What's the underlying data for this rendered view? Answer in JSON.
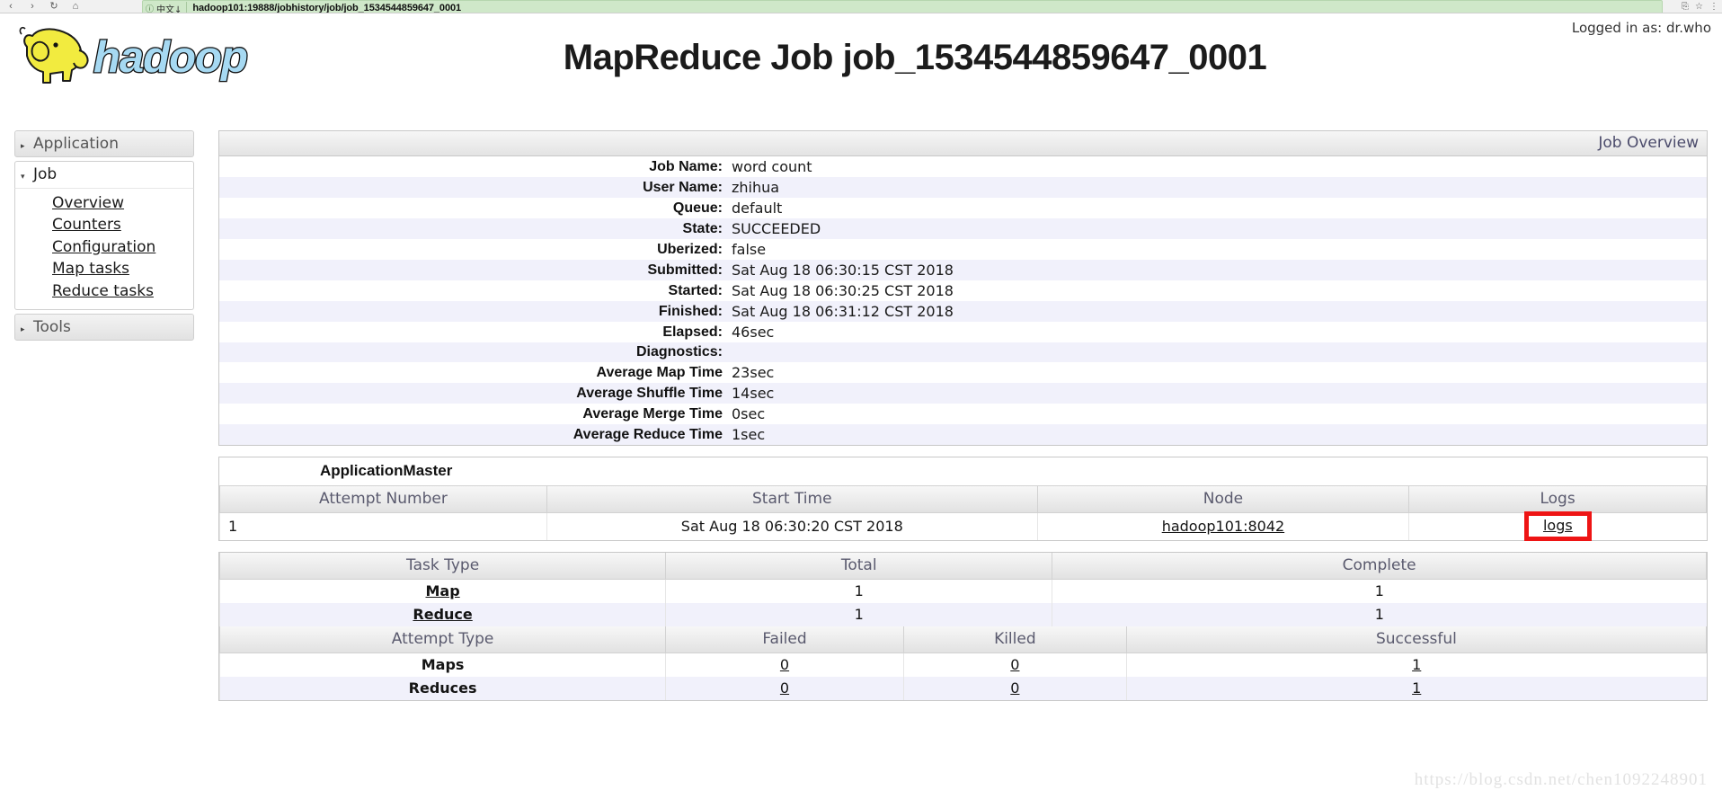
{
  "browser": {
    "back_icon": "‹",
    "forward_icon": "›",
    "reload_icon": "↻",
    "home_icon": "⌂",
    "secure_icon": "ⓘ",
    "lang_tag": "中文↓",
    "url_host": "hadoop101:19888",
    "url_path": "/jobhistory/job/job_1534544859647_0001",
    "cast_icon": "⎘",
    "star_icon": "☆",
    "menu_icon": "⋮"
  },
  "header": {
    "logged_in": "Logged in as: dr.who",
    "logo_text": "hadoop",
    "title": "MapReduce Job job_1534544859647_0001"
  },
  "sidebar": {
    "sections": [
      {
        "label": "Application",
        "expanded": false,
        "arrow": "▸"
      },
      {
        "label": "Job",
        "expanded": true,
        "arrow": "▾"
      },
      {
        "label": "Tools",
        "expanded": false,
        "arrow": "▸"
      }
    ],
    "job_links": [
      "Overview",
      "Counters",
      "Configuration",
      "Map tasks",
      "Reduce tasks"
    ]
  },
  "overview": {
    "caption": "Job Overview",
    "rows": [
      {
        "label": "Job Name:",
        "value": "word count"
      },
      {
        "label": "User Name:",
        "value": "zhihua"
      },
      {
        "label": "Queue:",
        "value": "default"
      },
      {
        "label": "State:",
        "value": "SUCCEEDED"
      },
      {
        "label": "Uberized:",
        "value": "false"
      },
      {
        "label": "Submitted:",
        "value": "Sat Aug 18 06:30:15 CST 2018"
      },
      {
        "label": "Started:",
        "value": "Sat Aug 18 06:30:25 CST 2018"
      },
      {
        "label": "Finished:",
        "value": "Sat Aug 18 06:31:12 CST 2018"
      },
      {
        "label": "Elapsed:",
        "value": "46sec"
      },
      {
        "label": "Diagnostics:",
        "value": ""
      },
      {
        "label": "Average Map Time",
        "value": "23sec"
      },
      {
        "label": "Average Shuffle Time",
        "value": "14sec"
      },
      {
        "label": "Average Merge Time",
        "value": "0sec"
      },
      {
        "label": "Average Reduce Time",
        "value": "1sec"
      }
    ]
  },
  "app_master": {
    "title": "ApplicationMaster",
    "headers": [
      "Attempt Number",
      "Start Time",
      "Node",
      "Logs"
    ],
    "row": {
      "attempt_number": "1",
      "start_time": "Sat Aug 18 06:30:20 CST 2018",
      "node": "hadoop101:8042",
      "logs": "logs"
    },
    "highlight_color": "#ee1414"
  },
  "tasks": {
    "headers": [
      "Task Type",
      "Total",
      "Complete"
    ],
    "rows": [
      {
        "type": "Map",
        "total": "1",
        "complete": "1"
      },
      {
        "type": "Reduce",
        "total": "1",
        "complete": "1"
      }
    ]
  },
  "attempts": {
    "headers": [
      "Attempt Type",
      "Failed",
      "Killed",
      "Successful"
    ],
    "rows": [
      {
        "type": "Maps",
        "failed": "0",
        "killed": "0",
        "successful": "1"
      },
      {
        "type": "Reduces",
        "failed": "0",
        "killed": "0",
        "successful": "1"
      }
    ]
  },
  "watermark": "https://blog.csdn.net/chen1092248901"
}
